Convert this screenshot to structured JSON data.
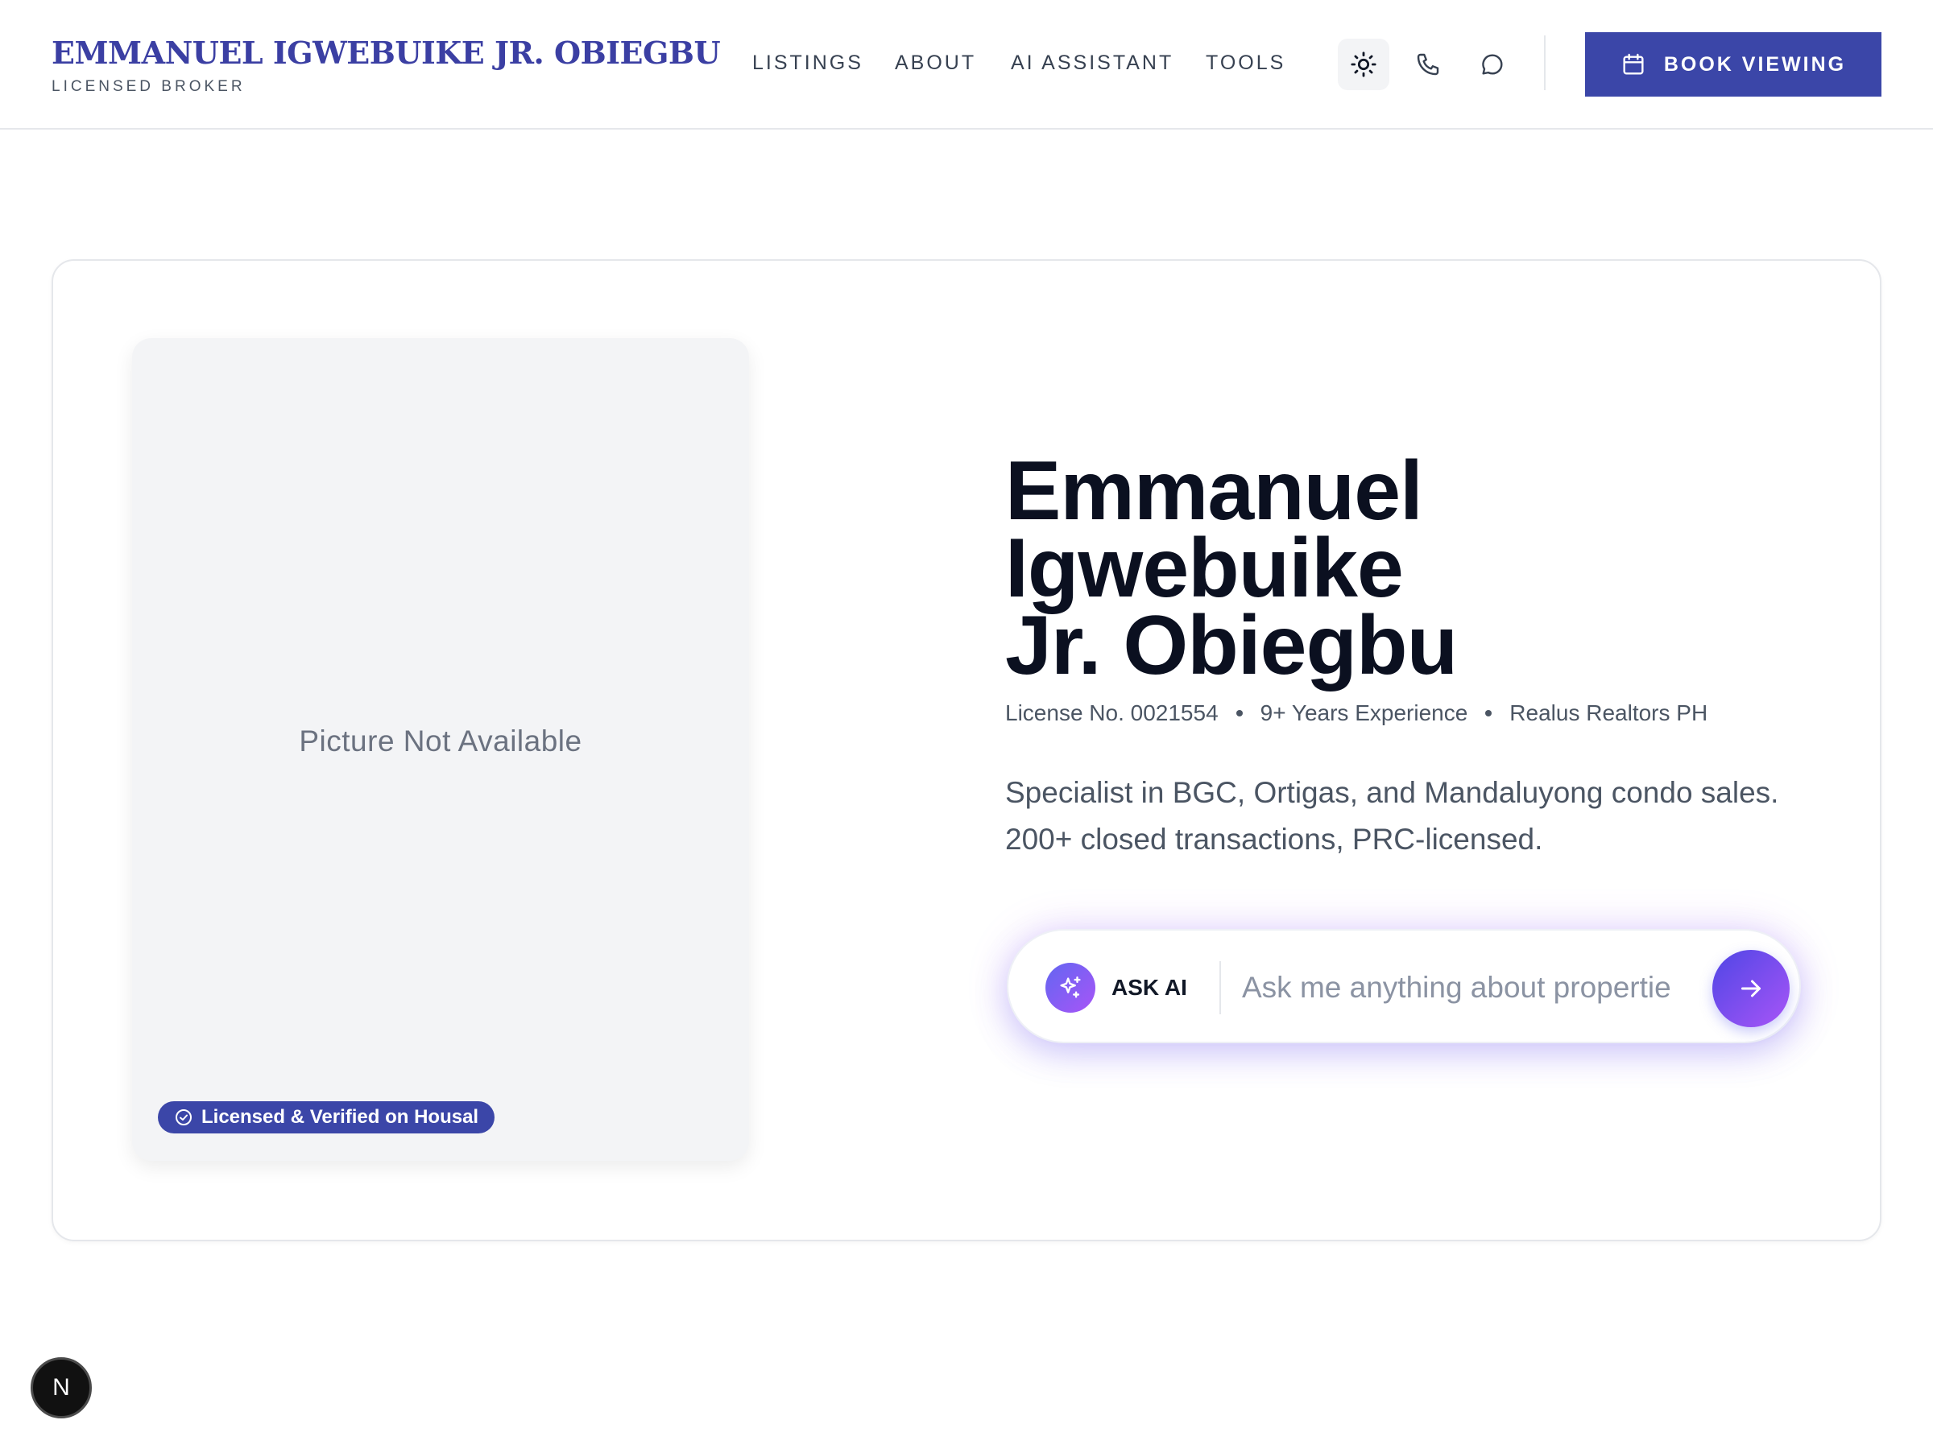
{
  "header": {
    "brand_name": "EMMANUEL IGWEBUIKE JR. OBIEGBU",
    "brand_subtitle": "LICENSED BROKER",
    "nav": [
      "LISTINGS",
      "ABOUT",
      "AI ASSISTANT",
      "TOOLS"
    ],
    "icons": [
      "sun-icon",
      "phone-icon",
      "chat-icon"
    ],
    "book_label": "BOOK VIEWING",
    "accent_color": "#3b46a8"
  },
  "profile": {
    "photo_placeholder": "Picture Not Available",
    "verified_badge": "Licensed & Verified on Housal",
    "name_lines": [
      "Emmanuel",
      "Igwebuike",
      "Jr. Obiegbu"
    ],
    "meta": [
      "License No. 0021554",
      "9+ Years Experience",
      "Realus Realtors PH"
    ],
    "bio_lines": [
      "Specialist in BGC, Ortigas, and Mandaluyong condo sales.",
      "200+ closed transactions, PRC-licensed."
    ]
  },
  "ask_ai": {
    "label": "ASK AI",
    "placeholder": "Ask me anything about propertie",
    "value": ""
  },
  "floating_badge": {
    "letter": "N"
  }
}
